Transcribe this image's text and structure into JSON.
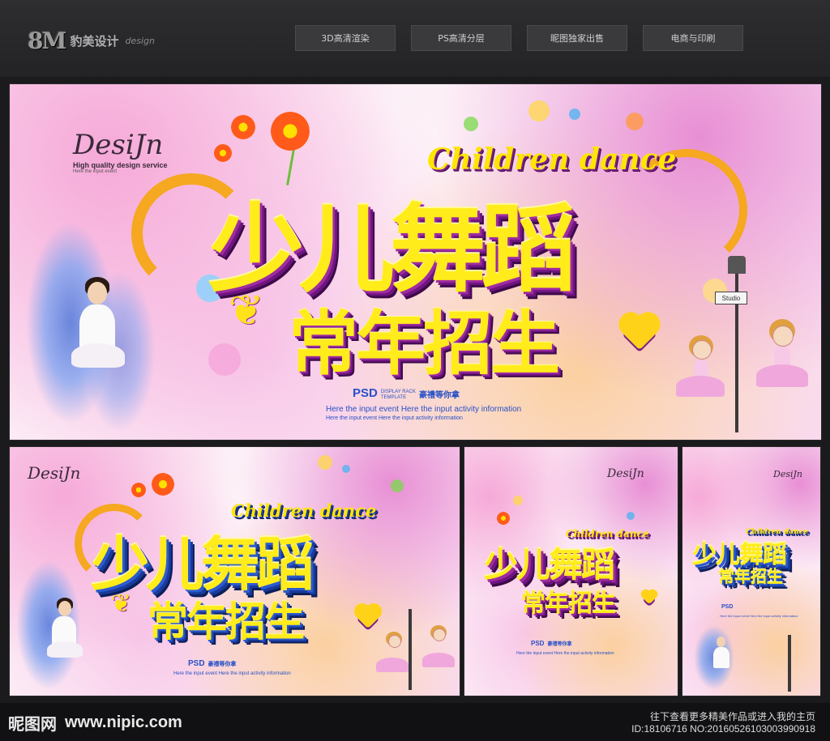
{
  "header": {
    "logo_mark": "8M",
    "logo_text": "豹美设计",
    "logo_sub": "design",
    "nav": [
      "3D高清渲染",
      "PS高清分层",
      "昵图独家出售",
      "电商与印刷"
    ]
  },
  "poster": {
    "design_logo": "DesiJn",
    "design_tagline": "High quality design service",
    "design_small": "Here the input event",
    "title_en": "Children dance",
    "title_cn_line1": "少儿舞蹈",
    "title_cn_line2": "常年招生",
    "psd": "PSD",
    "rack_line1": "DISPLAY RACK",
    "rack_line2": "TEMPLATE",
    "reward": "豪禮等你拿",
    "info_line1": "Here the input event   Here the input activity information",
    "info_line2": "Here the input event   Here the input activity information",
    "studio_sign": "Studio"
  },
  "footer": {
    "site_logo": "昵图网",
    "site_url": "www.nipic.com",
    "promo": "往下查看更多精美作品或进入我的主页",
    "id_text": "ID:18106716 NO:20160526103003990918"
  },
  "colors": {
    "title_yellow": "#ffec1a",
    "purple_depth": "#7a1f86",
    "blue_depth": "#1a3a9a",
    "info_blue": "#2850c8"
  }
}
